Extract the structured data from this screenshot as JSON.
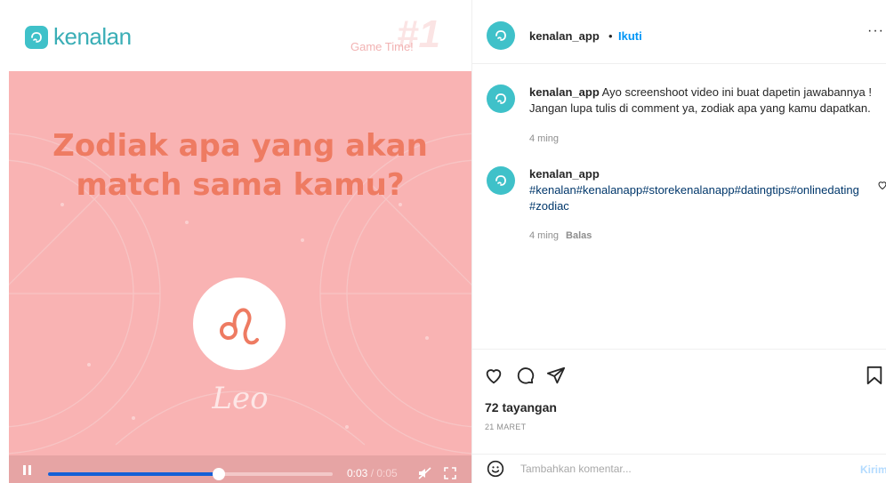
{
  "video": {
    "brand_name": "kenalan",
    "game_time_label": "Game Time!",
    "game_number": "#1",
    "headline_line1": "Zodiak apa yang akan",
    "headline_line2": "match sama kamu?",
    "zodiac_name": "Leo",
    "zodiac_symbol": "♌",
    "progress_fraction": 0.6,
    "time_current": "0:03",
    "time_separator": " / ",
    "time_total": "0:05"
  },
  "post": {
    "header": {
      "username": "kenalan_app",
      "separator": "•",
      "follow_label": "Ikuti",
      "more_label": "···"
    },
    "comments": [
      {
        "username": "kenalan_app",
        "text": "Ayo screenshoot video ini buat dapetin jawabannya ! Jangan lupa tulis di comment ya, zodiak apa yang kamu dapatkan.",
        "age": "4 ming",
        "reply_label": ""
      },
      {
        "username": "kenalan_app",
        "text": "#kenalan#kenalanapp#storekenalanapp#datingtips#onlinedating#zodiac",
        "age": "4 ming",
        "reply_label": "Balas"
      }
    ],
    "views": "72 tayangan",
    "date": "21 MARET",
    "comment_placeholder": "Tambahkan komentar...",
    "post_label": "Kirim"
  },
  "colors": {
    "brand_teal": "#3fc1c9",
    "video_bg": "#f9b3b3",
    "headline": "#ee7b62",
    "progress": "#1560d6",
    "link_blue": "#0095f6"
  }
}
